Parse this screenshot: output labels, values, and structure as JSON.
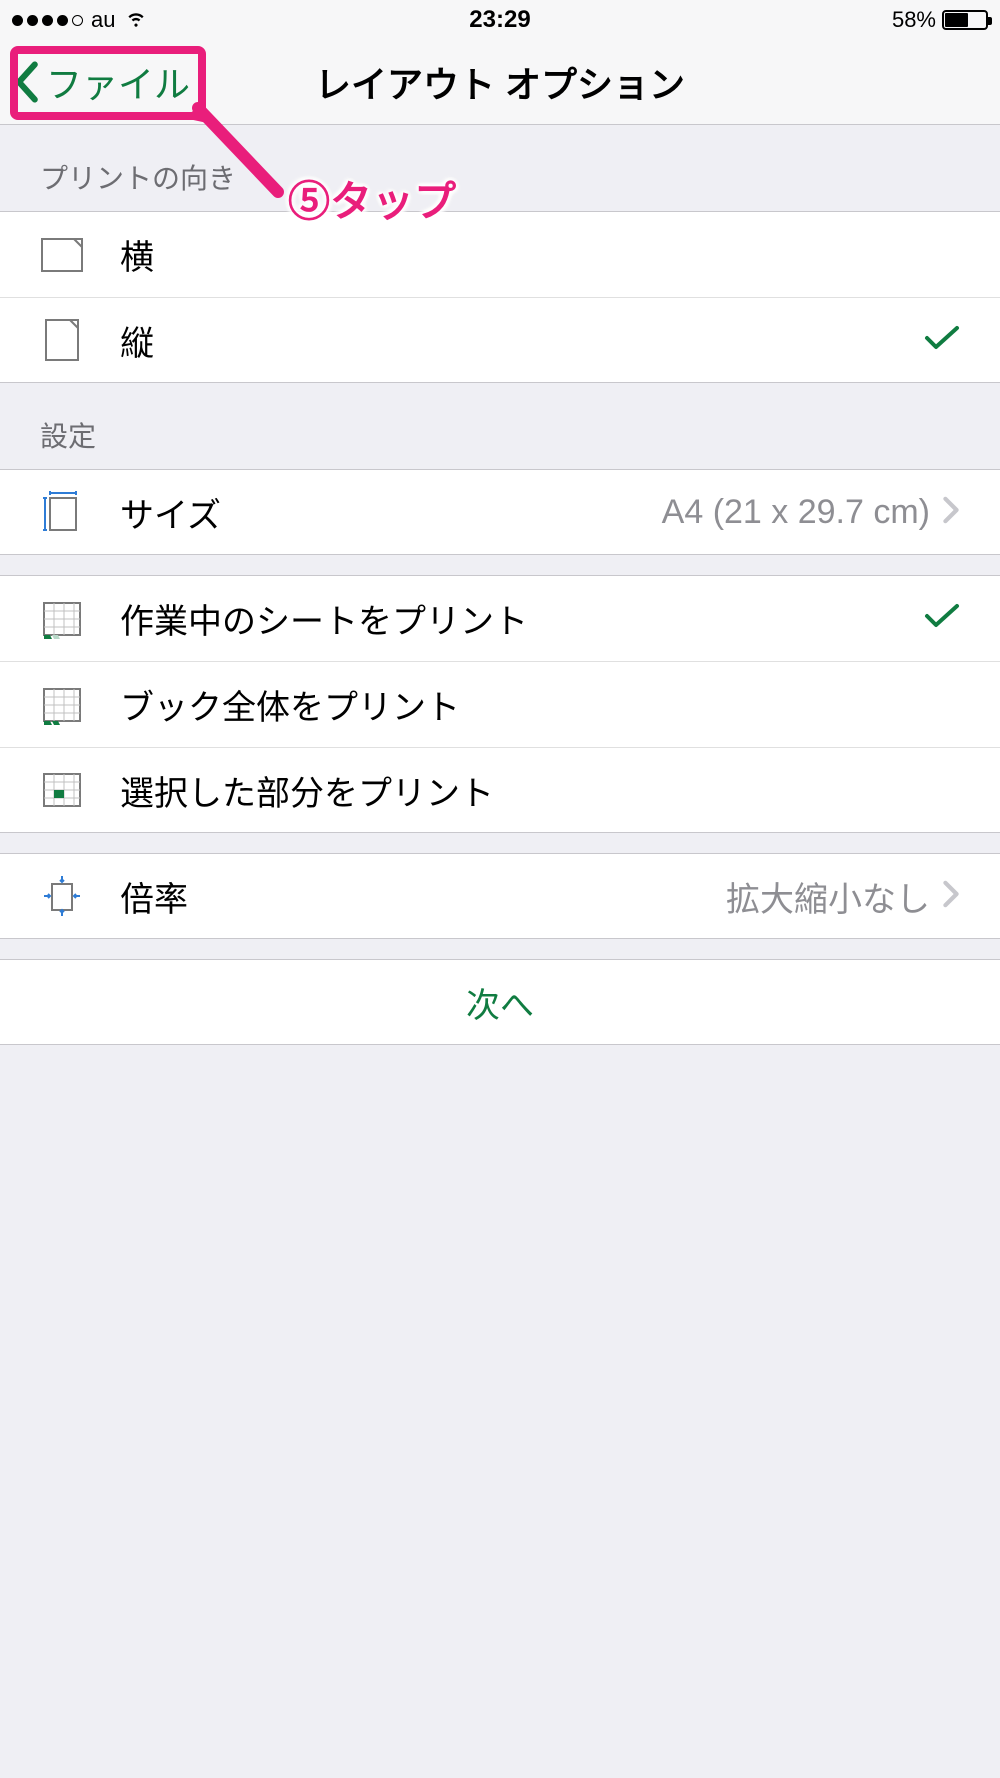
{
  "status": {
    "carrier": "au",
    "time": "23:29",
    "battery": "58%"
  },
  "nav": {
    "back_label": "ファイル",
    "title": "レイアウト オプション"
  },
  "annotation": {
    "text": "⑤タップ"
  },
  "orientation": {
    "header": "プリントの向き",
    "landscape": "横",
    "portrait": "縦"
  },
  "settings": {
    "header": "設定",
    "size_label": "サイズ",
    "size_value": "A4 (21 x 29.7 cm)",
    "print_active": "作業中のシートをプリント",
    "print_book": "ブック全体をプリント",
    "print_selection": "選択した部分をプリント",
    "scale_label": "倍率",
    "scale_value": "拡大縮小なし"
  },
  "next_label": "次へ"
}
